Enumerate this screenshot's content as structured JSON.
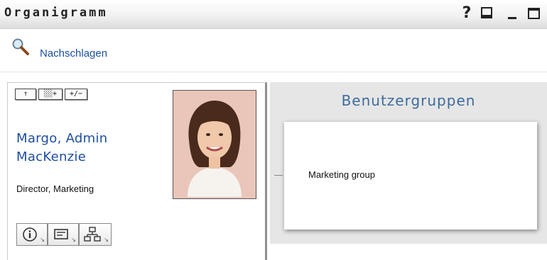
{
  "window": {
    "title": "Organigramm",
    "icons": [
      "help-icon",
      "print-icon",
      "minimize-icon",
      "maximize-icon"
    ],
    "help_label": "?"
  },
  "search": {
    "link_label": "Nachschlagen",
    "icon": "search-icon"
  },
  "person": {
    "name_line1": "Margo, Admin",
    "name_line2": "MacKenzie",
    "job_title": "Director, Marketing",
    "nav_buttons": [
      "↑",
      "░░+",
      "+/−"
    ],
    "actions": [
      "info-icon",
      "contact-card-icon",
      "org-chart-icon"
    ]
  },
  "groups": {
    "heading": "Benutzergruppen",
    "items": [
      "Marketing group"
    ]
  },
  "colors": {
    "link": "#1a4d9e",
    "name": "#1f4ea1",
    "heading": "#3e6c9c",
    "panel_bg": "#e6e6e6"
  }
}
